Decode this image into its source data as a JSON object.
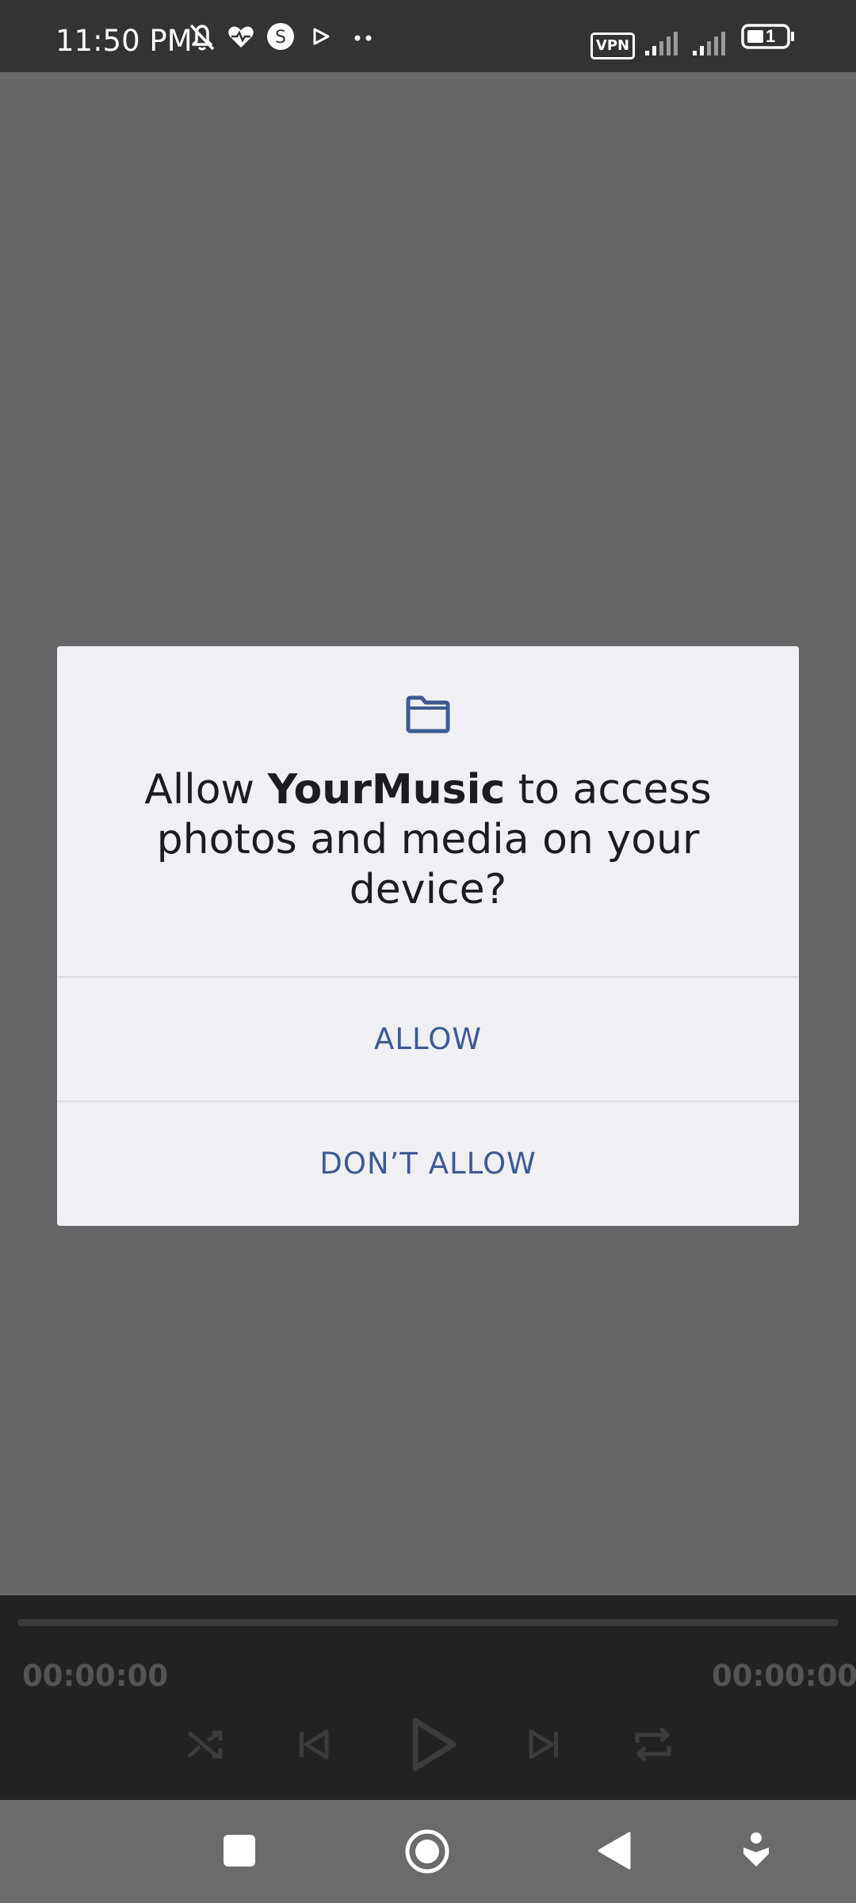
{
  "status_bar": {
    "time": "11:50 PM",
    "vpn_label": "VPN",
    "battery_level": "1",
    "icons": [
      "bell-off-icon",
      "heart-icon",
      "s-app-icon",
      "play-store-icon",
      "more-dots-icon",
      "signal-icon",
      "signal-icon",
      "battery-icon"
    ]
  },
  "dialog": {
    "title_prefix": "Allow ",
    "app_name": "YourMusic",
    "title_suffix": " to access photos and media on your device?",
    "icon": "folder-icon",
    "accent_color": "#3f5a93",
    "allow_label": "ALLOW",
    "deny_label": "DON’T ALLOW"
  },
  "player": {
    "elapsed": "00:00:00",
    "duration": "00:00:00",
    "progress": 0,
    "controls": [
      "shuffle-icon",
      "previous-icon",
      "play-icon",
      "next-icon",
      "repeat-icon"
    ]
  },
  "nav_bar": {
    "buttons": [
      "recents-button",
      "home-button",
      "back-button",
      "accessibility-button"
    ]
  }
}
